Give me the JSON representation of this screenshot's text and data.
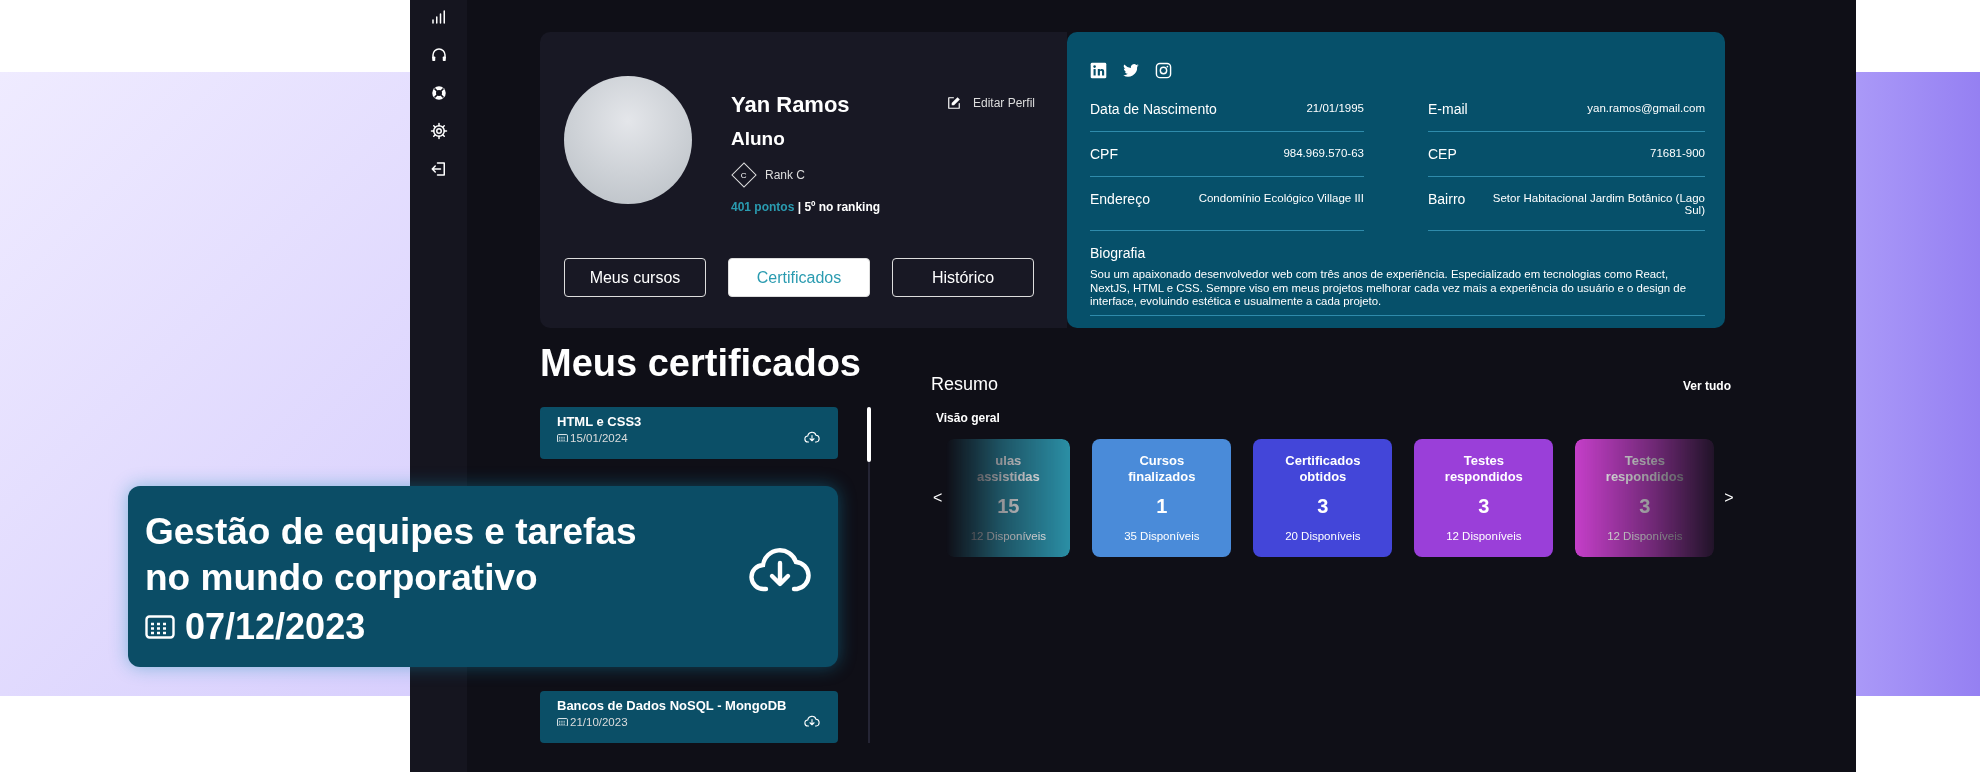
{
  "profile": {
    "name": "Yan Ramos",
    "role": "Aluno",
    "edit_label": "Editar Perfil",
    "rank_badge": "C",
    "rank": "Rank C",
    "points": "401 pontos",
    "ranking": "| 5º no ranking"
  },
  "tabs": [
    {
      "label": "Meus cursos",
      "selected": false
    },
    {
      "label": "Certificados",
      "selected": true
    },
    {
      "label": "Histórico",
      "selected": false
    }
  ],
  "details": {
    "fields": [
      {
        "label": "Data de Nascimento",
        "value": "21/01/1995"
      },
      {
        "label": "E-mail",
        "value": "yan.ramos@gmail.com"
      },
      {
        "label": "CPF",
        "value": "984.969.570-63"
      },
      {
        "label": "CEP",
        "value": "71681-900"
      },
      {
        "label": "Endereço",
        "value": "Condomínio Ecológico Village III"
      },
      {
        "label": "Bairro",
        "value": "Setor Habitacional Jardim Botânico (Lago Sul)"
      }
    ],
    "bio_label": "Biografia",
    "bio": "Sou um apaixonado desenvolvedor web com três anos de experiência. Especializado em tecnologias como React, NextJS, HTML e CSS. Sempre viso em meus projetos melhorar cada vez mais a experiência do usuário e o design de interface, evoluindo estética e usualmente a cada projeto."
  },
  "certificates": {
    "title": "Meus certificados",
    "items": [
      {
        "name": "HTML e CSS3",
        "date": "15/01/2024"
      },
      {
        "name": "Bancos de Dados NoSQL - MongoDB",
        "date": "21/10/2023"
      }
    ],
    "featured": {
      "name": "Gestão de equipes e tarefas no mundo corporativo",
      "date": "07/12/2023"
    }
  },
  "summary": {
    "title": "Resumo",
    "link": "Ver tudo",
    "subtitle": "Visão geral",
    "prev": "<",
    "next": ">",
    "cards": [
      {
        "title": "ulas assistidas",
        "value": "15",
        "note": "12 Disponíveis",
        "color": "#2b8fa6",
        "fade_left": true,
        "fade_right": false
      },
      {
        "title": "Cursos finalizados",
        "value": "1",
        "note": "35 Disponíveis",
        "color": "#4a8bd9",
        "fade_left": false,
        "fade_right": false
      },
      {
        "title": "Certificados obtidos",
        "value": "3",
        "note": "20 Disponíveis",
        "color": "#4346d9",
        "fade_left": false,
        "fade_right": false
      },
      {
        "title": "Testes respondidos",
        "value": "3",
        "note": "12 Disponíveis",
        "color": "#9a3fd9",
        "fade_left": false,
        "fade_right": false
      },
      {
        "title": "Testes respondidos",
        "value": "3",
        "note": "12 Disponíveis",
        "color": "#c53fc9",
        "fade_left": false,
        "fade_right": true
      }
    ]
  }
}
